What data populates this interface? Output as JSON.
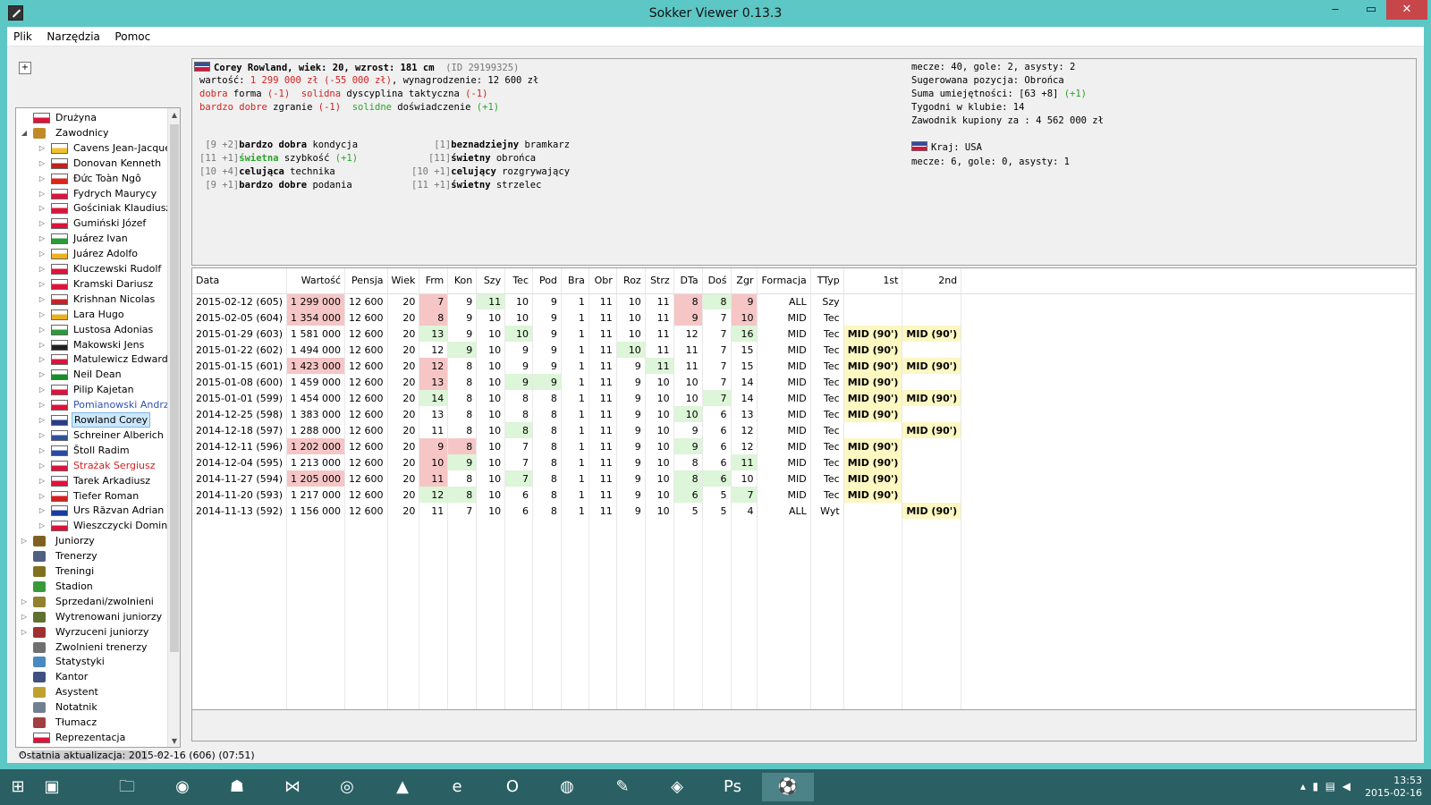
{
  "window": {
    "title": "Sokker Viewer 0.13.3",
    "min": "‒",
    "max": "▭",
    "close": "✕"
  },
  "menu": [
    "Plik",
    "Narzędzia",
    "Pomoc"
  ],
  "tree": [
    {
      "label": "Drużyna",
      "level": 0,
      "exp": "",
      "icon": "flag-icon",
      "color": "#dc143c"
    },
    {
      "label": "Zawodnicy",
      "level": 0,
      "exp": "◢",
      "icon": "player-icon",
      "color": "#c08a28"
    },
    {
      "label": "Cavens Jean-Jacques",
      "level": 1,
      "exp": "▷",
      "icon": "flag-icon",
      "color": "#f0c030"
    },
    {
      "label": "Donovan Kenneth",
      "level": 1,
      "exp": "▷",
      "icon": "flag-icon",
      "color": "#c02020"
    },
    {
      "label": "Đức Toàn Ngô",
      "level": 1,
      "exp": "▷",
      "icon": "flag-icon",
      "color": "#da251d"
    },
    {
      "label": "Fydrych Maurycy",
      "level": 1,
      "exp": "▷",
      "icon": "flag-icon",
      "color": "#dc143c"
    },
    {
      "label": "Gościniak Klaudiusz",
      "level": 1,
      "exp": "▷",
      "icon": "flag-icon",
      "color": "#dc143c"
    },
    {
      "label": "Gumiński Józef",
      "level": 1,
      "exp": "▷",
      "icon": "flag-icon",
      "color": "#dc143c"
    },
    {
      "label": "Juárez Ivan",
      "level": 1,
      "exp": "▷",
      "icon": "flag-icon",
      "color": "#2a9a3a"
    },
    {
      "label": "Juárez Adolfo",
      "level": 1,
      "exp": "▷",
      "icon": "flag-icon",
      "color": "#f0b020"
    },
    {
      "label": "Kluczewski Rudolf",
      "level": 1,
      "exp": "▷",
      "icon": "flag-icon",
      "color": "#dc143c"
    },
    {
      "label": "Kramski Dariusz",
      "level": 1,
      "exp": "▷",
      "icon": "flag-icon",
      "color": "#dc143c"
    },
    {
      "label": "Krishnan Nicolas",
      "level": 1,
      "exp": "▷",
      "icon": "flag-icon",
      "color": "#c8202a"
    },
    {
      "label": "Lara Hugo",
      "level": 1,
      "exp": "▷",
      "icon": "flag-icon",
      "color": "#e8b020"
    },
    {
      "label": "Lustosa Adonias",
      "level": 1,
      "exp": "▷",
      "icon": "flag-icon",
      "color": "#2a9a3a"
    },
    {
      "label": "Makowski Jens",
      "level": 1,
      "exp": "▷",
      "icon": "flag-icon",
      "color": "#202020"
    },
    {
      "label": "Matulewicz Edward",
      "level": 1,
      "exp": "▷",
      "icon": "flag-icon",
      "color": "#dc143c"
    },
    {
      "label": "Neil Dean",
      "level": 1,
      "exp": "▷",
      "icon": "flag-icon",
      "color": "#1a8a2a"
    },
    {
      "label": "Pilip Kajetan",
      "level": 1,
      "exp": "▷",
      "icon": "flag-icon",
      "color": "#dc143c"
    },
    {
      "label": "Pomianowski Andrzej",
      "level": 1,
      "exp": "▷",
      "icon": "flag-icon",
      "color": "#dc143c",
      "text_color": "#3050b0"
    },
    {
      "label": "Rowland Corey",
      "level": 1,
      "exp": "▷",
      "icon": "flag-icon",
      "color": "#2a3a8a",
      "selected": true
    },
    {
      "label": "Schreiner Alberich",
      "level": 1,
      "exp": "▷",
      "icon": "flag-icon",
      "color": "#3050a0"
    },
    {
      "label": "Štoll Radim",
      "level": 1,
      "exp": "▷",
      "icon": "flag-icon",
      "color": "#2a4aa0"
    },
    {
      "label": "Strażak Sergiusz",
      "level": 1,
      "exp": "▷",
      "icon": "flag-icon",
      "color": "#dc143c",
      "text_color": "#d42020"
    },
    {
      "label": "Tarek Arkadiusz",
      "level": 1,
      "exp": "▷",
      "icon": "flag-icon",
      "color": "#dc143c"
    },
    {
      "label": "Tiefer Roman",
      "level": 1,
      "exp": "▷",
      "icon": "flag-icon",
      "color": "#d42020"
    },
    {
      "label": "Urs Răzvan Adrian",
      "level": 1,
      "exp": "▷",
      "icon": "flag-icon",
      "color": "#1a3aa0"
    },
    {
      "label": "Wieszczycki Dominik",
      "level": 1,
      "exp": "▷",
      "icon": "flag-icon",
      "color": "#dc143c"
    },
    {
      "label": "Juniorzy",
      "level": 0,
      "exp": "▷",
      "icon": "junior-icon",
      "color": "#806020"
    },
    {
      "label": "Trenerzy",
      "level": 0,
      "exp": "",
      "icon": "coach-icon",
      "color": "#506080"
    },
    {
      "label": "Treningi",
      "level": 0,
      "exp": "",
      "icon": "training-icon",
      "color": "#807020"
    },
    {
      "label": "Stadion",
      "level": 0,
      "exp": "",
      "icon": "stadium-icon",
      "color": "#3a9a3a"
    },
    {
      "label": "Sprzedani/zwolnieni",
      "level": 0,
      "exp": "▷",
      "icon": "sold-icon",
      "color": "#908030"
    },
    {
      "label": "Wytrenowani juniorzy",
      "level": 0,
      "exp": "▷",
      "icon": "trained-junior-icon",
      "color": "#607030"
    },
    {
      "label": "Wyrzuceni juniorzy",
      "level": 0,
      "exp": "▷",
      "icon": "fired-junior-icon",
      "color": "#a03030"
    },
    {
      "label": "Zwolnieni trenerzy",
      "level": 0,
      "exp": "",
      "icon": "fired-coach-icon",
      "color": "#707070"
    },
    {
      "label": "Statystyki",
      "level": 0,
      "exp": "",
      "icon": "stats-icon",
      "color": "#4a8ac0"
    },
    {
      "label": "Kantor",
      "level": 0,
      "exp": "",
      "icon": "exchange-icon",
      "color": "#405080"
    },
    {
      "label": "Asystent",
      "level": 0,
      "exp": "",
      "icon": "assistant-icon",
      "color": "#c0a030"
    },
    {
      "label": "Notatnik",
      "level": 0,
      "exp": "",
      "icon": "notebook-icon",
      "color": "#708090"
    },
    {
      "label": "Tłumacz",
      "level": 0,
      "exp": "",
      "icon": "translator-icon",
      "color": "#a04040"
    },
    {
      "label": "Reprezentacja",
      "level": 0,
      "exp": "",
      "icon": "flag-icon",
      "color": "#dc143c"
    }
  ],
  "info": {
    "name_line": "Corey Rowland, wiek: 20, wzrost: 181 cm",
    "id": "(ID 29199325)",
    "value_label": "wartość: ",
    "value": "1 299 000 zł",
    "value_delta": "(-55 000 zł)",
    "salary": ", wynagrodzenie: 12 600 zł",
    "line3": [
      {
        "t": "dobra",
        "c": "red"
      },
      {
        "t": " forma ",
        "c": ""
      },
      {
        "t": "(-1)",
        "c": "red"
      },
      {
        "t": "  solidna",
        "c": "red"
      },
      {
        "t": " dyscyplina taktyczna ",
        "c": ""
      },
      {
        "t": "(-1)",
        "c": "red"
      }
    ],
    "line4": [
      {
        "t": "bardzo dobre",
        "c": "red"
      },
      {
        "t": " zgranie ",
        "c": ""
      },
      {
        "t": "(-1)",
        "c": "red"
      },
      {
        "t": "  solidne",
        "c": "green"
      },
      {
        "t": " doświadczenie ",
        "c": ""
      },
      {
        "t": "(+1)",
        "c": "green"
      }
    ],
    "skills_left": [
      {
        "pre": " [9 +2]",
        "b": "bardzo dobra",
        "rest": " kondycja",
        "c": ""
      },
      {
        "pre": "[11 +1]",
        "b": "świetna",
        "rest": " szybkość ",
        "extra": "(+1)",
        "c": "green"
      },
      {
        "pre": "[10 +4]",
        "b": "celująca",
        "rest": " technika",
        "c": ""
      },
      {
        "pre": " [9 +1]",
        "b": "bardzo dobre",
        "rest": " podania",
        "c": ""
      }
    ],
    "skills_right": [
      {
        "pre": "    [1]",
        "b": "beznadziejny",
        "rest": " bramkarz"
      },
      {
        "pre": "   [11]",
        "b": "świetny",
        "rest": " obrońca"
      },
      {
        "pre": "[10 +1]",
        "b": "celujący",
        "rest": " rozgrywający"
      },
      {
        "pre": "[11 +1]",
        "b": "świetny",
        "rest": " strzelec"
      }
    ],
    "right": {
      "matches": "mecze: 40, gole: 2, asysty: 2",
      "position": "Sugerowana pozycja: Obrońca",
      "skills_sum": "Suma umiejętności: [63 +8] ",
      "skills_sum_delta": "(+1)",
      "weeks": "Tygodni w klubie: 14",
      "bought": "Zawodnik kupiony za : 4 562 000 zł",
      "country": "Kraj: USA",
      "nt_matches": "mecze: 6, gole: 0, asysty: 1"
    }
  },
  "table": {
    "headers": [
      "Data",
      "Wartość",
      "Pensja",
      "Wiek",
      "Frm",
      "Kon",
      "Szy",
      "Tec",
      "Pod",
      "Bra",
      "Obr",
      "Roz",
      "Strz",
      "DTa",
      "Doś",
      "Zgr",
      "Formacja",
      "TTyp",
      "1st",
      "2nd"
    ],
    "rows": [
      [
        "2015-02-12 (605)",
        "1 299 000",
        "12 600",
        "20",
        "7",
        "9",
        "11",
        "10",
        "9",
        "1",
        "11",
        "10",
        "11",
        "8",
        "8",
        "9",
        "ALL",
        "Szy",
        "",
        ""
      ],
      [
        "2015-02-05 (604)",
        "1 354 000",
        "12 600",
        "20",
        "8",
        "9",
        "10",
        "10",
        "9",
        "1",
        "11",
        "10",
        "11",
        "9",
        "7",
        "10",
        "MID",
        "Tec",
        "",
        ""
      ],
      [
        "2015-01-29 (603)",
        "1 581 000",
        "12 600",
        "20",
        "13",
        "9",
        "10",
        "10",
        "9",
        "1",
        "11",
        "10",
        "11",
        "12",
        "7",
        "16",
        "MID",
        "Tec",
        "MID (90')",
        "MID (90')"
      ],
      [
        "2015-01-22 (602)",
        "1 494 000",
        "12 600",
        "20",
        "12",
        "9",
        "10",
        "9",
        "9",
        "1",
        "11",
        "10",
        "11",
        "11",
        "7",
        "15",
        "MID",
        "Tec",
        "MID (90')",
        ""
      ],
      [
        "2015-01-15 (601)",
        "1 423 000",
        "12 600",
        "20",
        "12",
        "8",
        "10",
        "9",
        "9",
        "1",
        "11",
        "9",
        "11",
        "11",
        "7",
        "15",
        "MID",
        "Tec",
        "MID (90')",
        "MID (90')"
      ],
      [
        "2015-01-08 (600)",
        "1 459 000",
        "12 600",
        "20",
        "13",
        "8",
        "10",
        "9",
        "9",
        "1",
        "11",
        "9",
        "10",
        "10",
        "7",
        "14",
        "MID",
        "Tec",
        "MID (90')",
        ""
      ],
      [
        "2015-01-01 (599)",
        "1 454 000",
        "12 600",
        "20",
        "14",
        "8",
        "10",
        "8",
        "8",
        "1",
        "11",
        "9",
        "10",
        "10",
        "7",
        "14",
        "MID",
        "Tec",
        "MID (90')",
        "MID (90')"
      ],
      [
        "2014-12-25 (598)",
        "1 383 000",
        "12 600",
        "20",
        "13",
        "8",
        "10",
        "8",
        "8",
        "1",
        "11",
        "9",
        "10",
        "10",
        "6",
        "13",
        "MID",
        "Tec",
        "MID (90')",
        ""
      ],
      [
        "2014-12-18 (597)",
        "1 288 000",
        "12 600",
        "20",
        "11",
        "8",
        "10",
        "8",
        "8",
        "1",
        "11",
        "9",
        "10",
        "9",
        "6",
        "12",
        "MID",
        "Tec",
        "",
        "MID (90')"
      ],
      [
        "2014-12-11 (596)",
        "1 202 000",
        "12 600",
        "20",
        "9",
        "8",
        "10",
        "7",
        "8",
        "1",
        "11",
        "9",
        "10",
        "9",
        "6",
        "12",
        "MID",
        "Tec",
        "MID (90')",
        ""
      ],
      [
        "2014-12-04 (595)",
        "1 213 000",
        "12 600",
        "20",
        "10",
        "9",
        "10",
        "7",
        "8",
        "1",
        "11",
        "9",
        "10",
        "8",
        "6",
        "11",
        "MID",
        "Tec",
        "MID (90')",
        ""
      ],
      [
        "2014-11-27 (594)",
        "1 205 000",
        "12 600",
        "20",
        "11",
        "8",
        "10",
        "7",
        "8",
        "1",
        "11",
        "9",
        "10",
        "8",
        "6",
        "10",
        "MID",
        "Tec",
        "MID (90')",
        ""
      ],
      [
        "2014-11-20 (593)",
        "1 217 000",
        "12 600",
        "20",
        "12",
        "8",
        "10",
        "6",
        "8",
        "1",
        "11",
        "9",
        "10",
        "6",
        "5",
        "7",
        "MID",
        "Tec",
        "MID (90')",
        ""
      ],
      [
        "2014-11-13 (592)",
        "1 156 000",
        "12 600",
        "20",
        "11",
        "7",
        "10",
        "6",
        "8",
        "1",
        "11",
        "9",
        "10",
        "5",
        "5",
        "4",
        "ALL",
        "Wyt",
        "",
        "MID (90')"
      ]
    ],
    "highlights": [
      [
        "",
        "red",
        "",
        "",
        "red",
        "",
        "grn",
        "",
        "",
        "",
        "",
        "",
        "",
        "red",
        "grn",
        "red",
        "",
        "",
        "",
        ""
      ],
      [
        "",
        "red",
        "",
        "",
        "red",
        "",
        "",
        "",
        "",
        "",
        "",
        "",
        "",
        "red",
        "",
        "red",
        "",
        "",
        "",
        ""
      ],
      [
        "",
        "",
        "",
        "",
        "grn",
        "",
        "",
        "grn",
        "",
        "",
        "",
        "",
        "",
        "",
        "",
        "grn",
        "",
        "",
        "yel",
        "yel"
      ],
      [
        "",
        "",
        "",
        "",
        "",
        "grn",
        "",
        "",
        "",
        "",
        "",
        "grn",
        "",
        "",
        "",
        "",
        "",
        "",
        "yel",
        ""
      ],
      [
        "",
        "red",
        "",
        "",
        "red",
        "",
        "",
        "",
        "",
        "",
        "",
        "",
        "grn",
        "",
        "",
        "",
        "",
        "",
        "yel",
        "yel"
      ],
      [
        "",
        "",
        "",
        "",
        "red",
        "",
        "",
        "grn",
        "grn",
        "",
        "",
        "",
        "",
        "",
        "",
        "",
        "",
        "",
        "yel",
        ""
      ],
      [
        "",
        "",
        "",
        "",
        "grn",
        "",
        "",
        "",
        "",
        "",
        "",
        "",
        "",
        "",
        "grn",
        "",
        "",
        "",
        "yel",
        "yel"
      ],
      [
        "",
        "",
        "",
        "",
        "",
        "",
        "",
        "",
        "",
        "",
        "",
        "",
        "",
        "grn",
        "",
        "",
        "",
        "",
        "yel",
        ""
      ],
      [
        "",
        "",
        "",
        "",
        "",
        "",
        "",
        "grn",
        "",
        "",
        "",
        "",
        "",
        "",
        "",
        "",
        "",
        "",
        "",
        "yel"
      ],
      [
        "",
        "red",
        "",
        "",
        "red",
        "red",
        "",
        "",
        "",
        "",
        "",
        "",
        "",
        "grn",
        "",
        "",
        "",
        "",
        "yel",
        ""
      ],
      [
        "",
        "",
        "",
        "",
        "red",
        "grn",
        "",
        "",
        "",
        "",
        "",
        "",
        "",
        "",
        "",
        "grn",
        "",
        "",
        "yel",
        ""
      ],
      [
        "",
        "red",
        "",
        "",
        "red",
        "",
        "",
        "grn",
        "",
        "",
        "",
        "",
        "",
        "grn",
        "grn",
        "",
        "",
        "",
        "yel",
        ""
      ],
      [
        "",
        "",
        "",
        "",
        "grn",
        "grn",
        "",
        "",
        "",
        "",
        "",
        "",
        "",
        "grn",
        "",
        "grn",
        "",
        "",
        "yel",
        ""
      ],
      [
        "",
        "",
        "",
        "",
        "",
        "",
        "",
        "",
        "",
        "",
        "",
        "",
        "",
        "",
        "",
        "",
        "",
        "",
        "",
        "yel"
      ]
    ]
  },
  "status": "Ostatnia aktualizacja: 2015-02-16 (606) (07:51)",
  "taskbar": {
    "time": "13:53",
    "date": "2015-02-16",
    "apps": [
      {
        "name": "windows-start-icon",
        "glyph": "⊞"
      },
      {
        "name": "store-icon",
        "glyph": "▣"
      },
      {
        "name": "explorer-icon",
        "glyph": "🗀"
      },
      {
        "name": "ie-blue-icon",
        "glyph": "◉"
      },
      {
        "name": "box-game-icon",
        "glyph": "☗"
      },
      {
        "name": "visual-studio-icon",
        "glyph": "⋈"
      },
      {
        "name": "eclipse-icon",
        "glyph": "◎"
      },
      {
        "name": "vlc-icon",
        "glyph": "▲"
      },
      {
        "name": "internet-explorer-icon",
        "glyph": "e"
      },
      {
        "name": "opera-icon",
        "glyph": "O"
      },
      {
        "name": "firefox-icon",
        "glyph": "◍"
      },
      {
        "name": "gimp-icon",
        "glyph": "✎"
      },
      {
        "name": "virtualbox-icon",
        "glyph": "◈"
      },
      {
        "name": "photoshop-icon",
        "glyph": "Ps"
      },
      {
        "name": "sokker-viewer-icon",
        "glyph": "⚽"
      }
    ]
  }
}
